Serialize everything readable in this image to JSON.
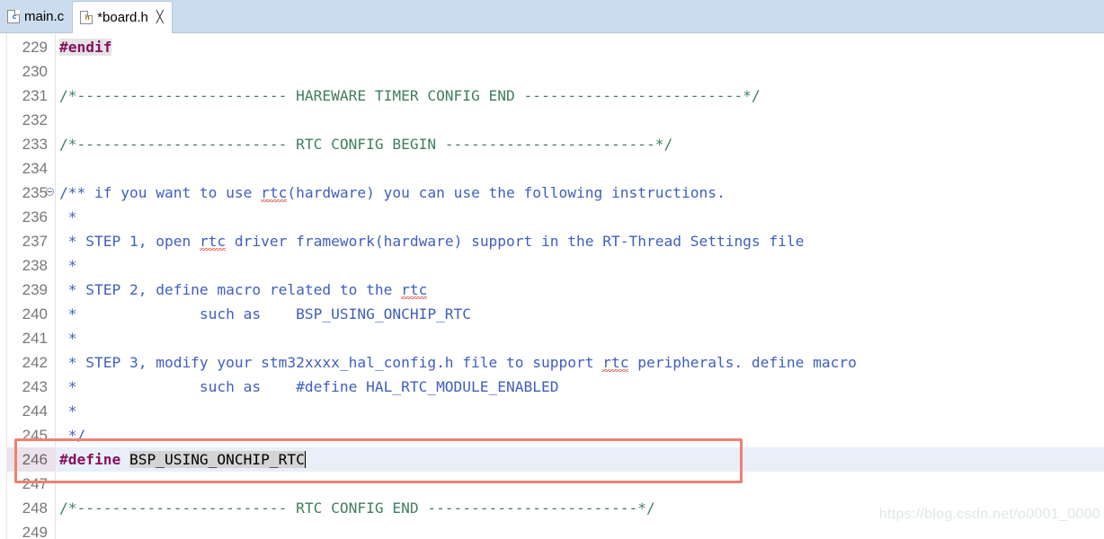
{
  "window": {
    "app": "Eclipse CDT Editor",
    "accent_tab_bg": "#cbdcee",
    "current_line_bg": "#e8eff9",
    "annotation_box_color": "#f08070",
    "comment_color": "#3f7f5f",
    "doc_comment_color": "#3f5fbf",
    "preprocessor_color": "#8a1060"
  },
  "tabs": [
    {
      "label": "main.c",
      "icon": "c-source-file-icon",
      "icon_letter": "c",
      "active": false,
      "dirty": false,
      "closeable": false
    },
    {
      "label": "*board.h",
      "icon": "h-header-file-icon",
      "icon_letter": "h",
      "active": true,
      "dirty": true,
      "closeable": true,
      "close_glyph": "╳"
    }
  ],
  "editor": {
    "first_visible_line": 229,
    "current_line": 246,
    "cursor_line": 246,
    "cursor_column": 28,
    "lines": [
      {
        "num": "229",
        "fold": false,
        "current": false,
        "segments": [
          {
            "text": "#endif",
            "style": "prep",
            "highlight": "prep-bg"
          }
        ]
      },
      {
        "num": "230",
        "fold": false,
        "current": false,
        "segments": []
      },
      {
        "num": "231",
        "fold": false,
        "current": false,
        "segments": [
          {
            "text": "/*------------------------ HAREWARE TIMER CONFIG END -------------------------*/",
            "style": "comment"
          }
        ]
      },
      {
        "num": "232",
        "fold": false,
        "current": false,
        "segments": []
      },
      {
        "num": "233",
        "fold": false,
        "current": false,
        "segments": [
          {
            "text": "/*------------------------ RTC CONFIG BEGIN ------------------------*/",
            "style": "comment"
          }
        ]
      },
      {
        "num": "234",
        "fold": false,
        "current": false,
        "segments": []
      },
      {
        "num": "235",
        "fold": true,
        "current": false,
        "segments": [
          {
            "text": "/** if you want to use ",
            "style": "doc"
          },
          {
            "text": "rtc",
            "style": "doc",
            "squiggle": true
          },
          {
            "text": "(hardware) you can use the following instructions.",
            "style": "doc"
          }
        ]
      },
      {
        "num": "236",
        "fold": false,
        "current": false,
        "segments": [
          {
            "text": " *",
            "style": "doc"
          }
        ]
      },
      {
        "num": "237",
        "fold": false,
        "current": false,
        "segments": [
          {
            "text": " * STEP 1, open ",
            "style": "doc"
          },
          {
            "text": "rtc",
            "style": "doc",
            "squiggle": true
          },
          {
            "text": " driver framework(hardware) support in the RT-Thread Settings file",
            "style": "doc"
          }
        ]
      },
      {
        "num": "238",
        "fold": false,
        "current": false,
        "segments": [
          {
            "text": " *",
            "style": "doc"
          }
        ]
      },
      {
        "num": "239",
        "fold": false,
        "current": false,
        "segments": [
          {
            "text": " * STEP 2, define macro related to the ",
            "style": "doc"
          },
          {
            "text": "rtc",
            "style": "doc",
            "squiggle": true
          }
        ]
      },
      {
        "num": "240",
        "fold": false,
        "current": false,
        "segments": [
          {
            "text": " *              such as    BSP_USING_ONCHIP_RTC",
            "style": "doc"
          }
        ]
      },
      {
        "num": "241",
        "fold": false,
        "current": false,
        "segments": [
          {
            "text": " *",
            "style": "doc"
          }
        ]
      },
      {
        "num": "242",
        "fold": false,
        "current": false,
        "segments": [
          {
            "text": " * STEP 3, modify your stm32xxxx_hal_config.h file to support ",
            "style": "doc"
          },
          {
            "text": "rtc",
            "style": "doc",
            "squiggle": true
          },
          {
            "text": " peripherals. define macro",
            "style": "doc"
          }
        ]
      },
      {
        "num": "243",
        "fold": false,
        "current": false,
        "segments": [
          {
            "text": " *              such as    #define HAL_RTC_MODULE_ENABLED",
            "style": "doc"
          }
        ]
      },
      {
        "num": "244",
        "fold": false,
        "current": false,
        "segments": [
          {
            "text": " *",
            "style": "doc"
          }
        ]
      },
      {
        "num": "245",
        "fold": false,
        "current": false,
        "segments": [
          {
            "text": " */",
            "style": "doc"
          }
        ]
      },
      {
        "num": "246",
        "fold": false,
        "current": true,
        "segments": [
          {
            "text": "#define ",
            "style": "prep"
          },
          {
            "text": "BSP_USING_ONCHIP_RTC",
            "style": "macro",
            "highlight": "tokenhl",
            "caret_after": true
          }
        ]
      },
      {
        "num": "247",
        "fold": false,
        "current": false,
        "segments": []
      },
      {
        "num": "248",
        "fold": false,
        "current": false,
        "segments": [
          {
            "text": "/*------------------------ RTC CONFIG END ------------------------*/",
            "style": "comment"
          }
        ]
      },
      {
        "num": "249",
        "fold": false,
        "current": false,
        "segments": []
      }
    ]
  },
  "annotation": {
    "type": "red-rectangle-highlight",
    "targets_line": "246"
  },
  "watermark": {
    "text": "https://blog.csdn.net/o0001_0000"
  }
}
